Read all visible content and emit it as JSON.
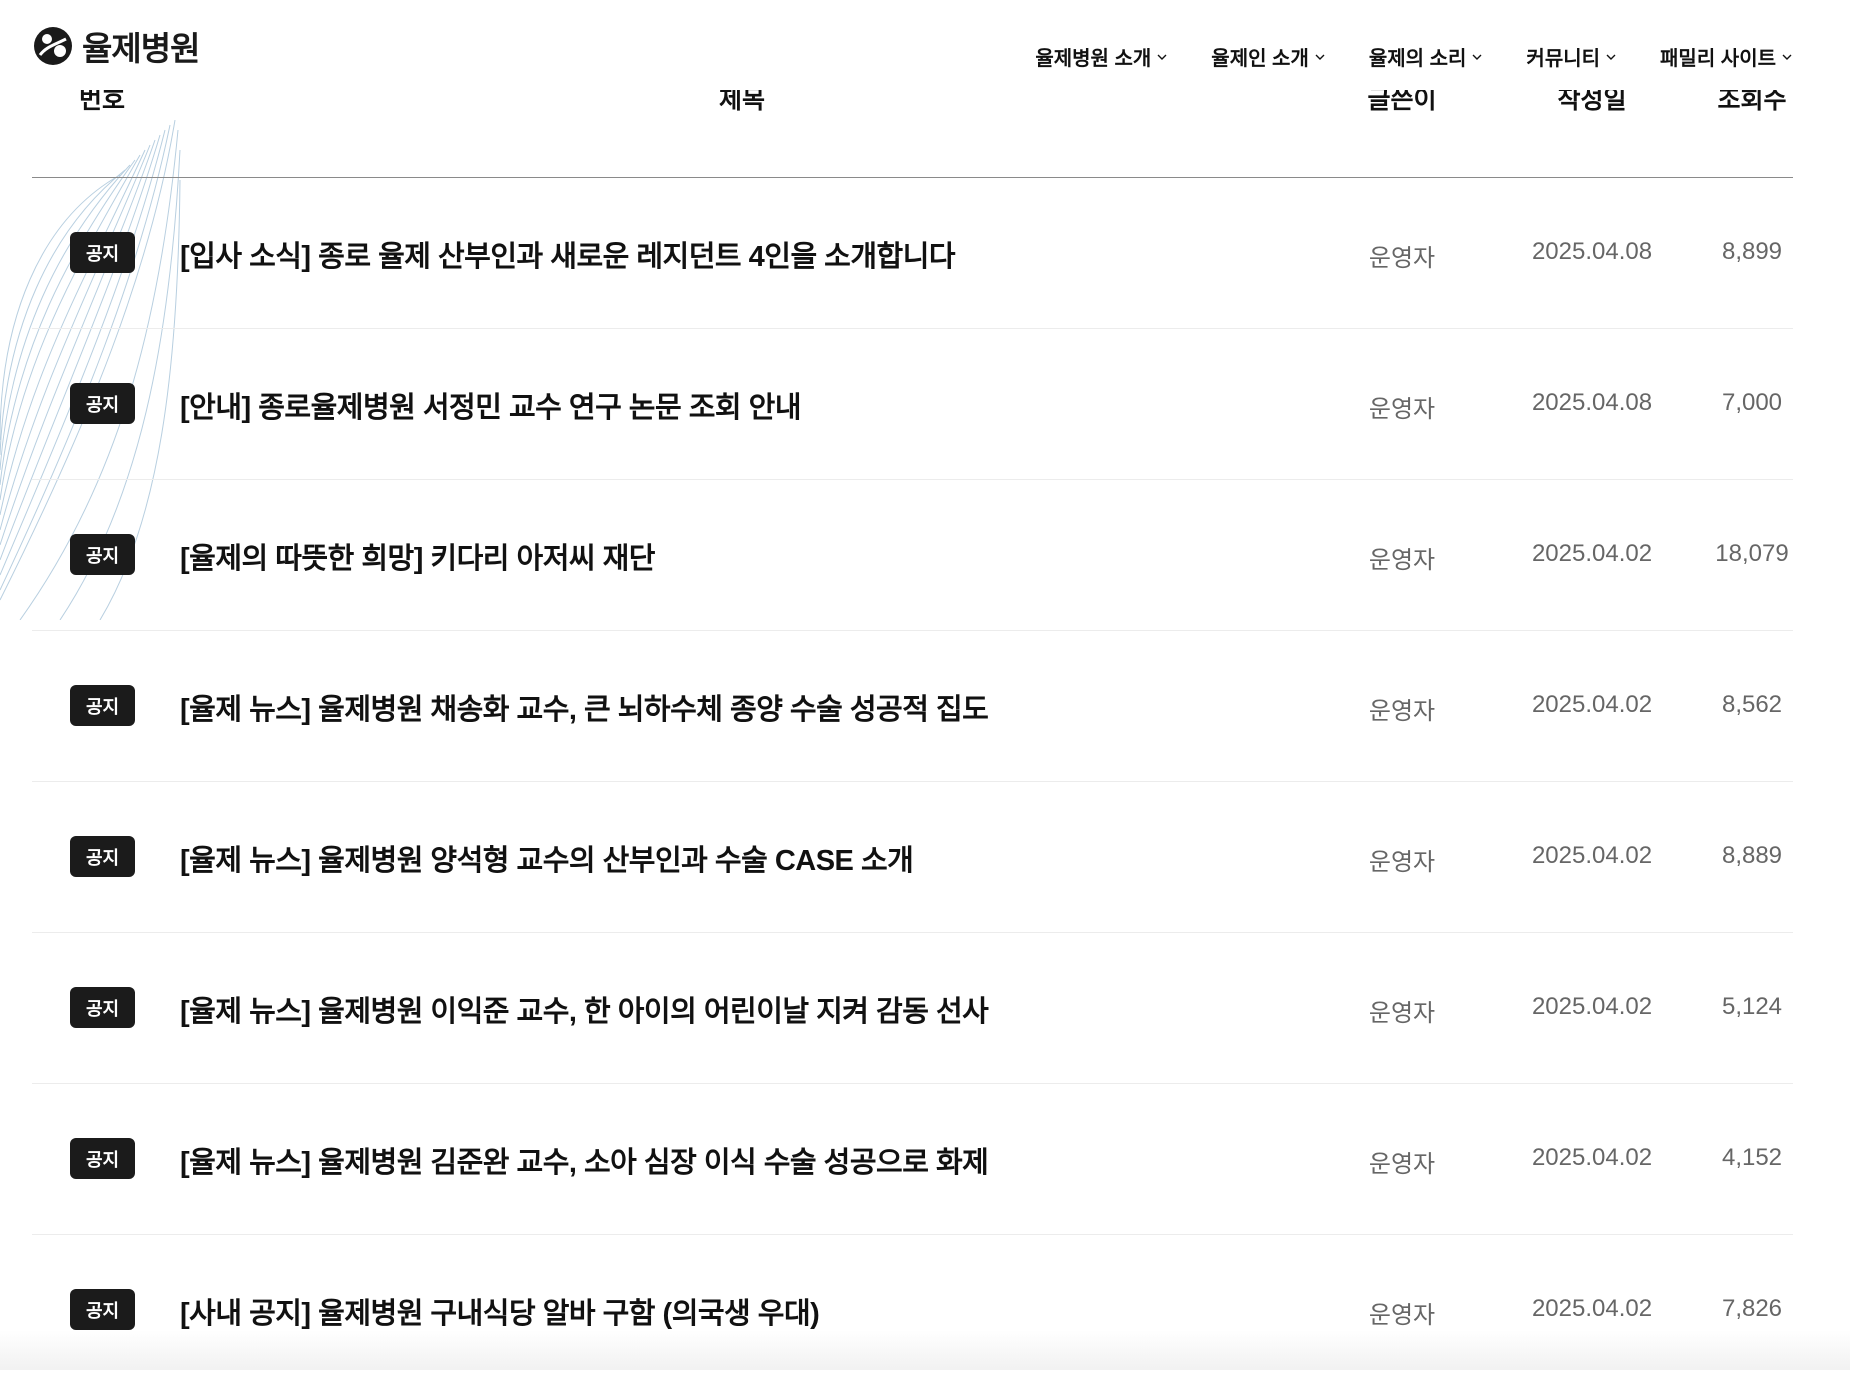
{
  "header": {
    "logo_text": "율제병원",
    "logo_icon": "yulje-logo-icon",
    "nav": [
      {
        "label": "율제병원 소개",
        "icon": "chevron-down-icon"
      },
      {
        "label": "율제인 소개",
        "icon": "chevron-down-icon"
      },
      {
        "label": "율제의 소리",
        "icon": "chevron-down-icon"
      },
      {
        "label": "커뮤니티",
        "icon": "chevron-down-icon"
      },
      {
        "label": "패밀리 사이트",
        "icon": "chevron-down-icon"
      }
    ]
  },
  "table": {
    "columns": {
      "number": "번호",
      "title": "제목",
      "author": "글쓴이",
      "date": "작성일",
      "views": "조회수"
    },
    "rows": [
      {
        "badge": "공지",
        "title": "[입사 소식] 종로 율제 산부인과 새로운 레지던트 4인을 소개합니다",
        "author": "운영자",
        "date": "2025.04.08",
        "views": "8,899"
      },
      {
        "badge": "공지",
        "title": "[안내] 종로율제병원 서정민 교수 연구 논문 조회 안내",
        "author": "운영자",
        "date": "2025.04.08",
        "views": "7,000"
      },
      {
        "badge": "공지",
        "title": "[율제의 따뜻한 희망] 키다리 아저씨 재단",
        "author": "운영자",
        "date": "2025.04.02",
        "views": "18,079"
      },
      {
        "badge": "공지",
        "title": "[율제 뉴스] 율제병원 채송화 교수, 큰 뇌하수체 종양 수술 성공적 집도",
        "author": "운영자",
        "date": "2025.04.02",
        "views": "8,562"
      },
      {
        "badge": "공지",
        "title": "[율제 뉴스] 율제병원 양석형 교수의 산부인과 수술 CASE 소개",
        "author": "운영자",
        "date": "2025.04.02",
        "views": "8,889"
      },
      {
        "badge": "공지",
        "title": "[율제 뉴스] 율제병원 이익준 교수, 한 아이의 어린이날 지켜 감동 선사",
        "author": "운영자",
        "date": "2025.04.02",
        "views": "5,124"
      },
      {
        "badge": "공지",
        "title": "[율제 뉴스] 율제병원 김준완 교수, 소아 심장 이식 수술 성공으로 화제",
        "author": "운영자",
        "date": "2025.04.02",
        "views": "4,152"
      },
      {
        "badge": "공지",
        "title": "[사내 공지] 율제병원 구내식당 알바 구함 (의국생 우대)",
        "author": "운영자",
        "date": "2025.04.02",
        "views": "7,826"
      }
    ]
  }
}
